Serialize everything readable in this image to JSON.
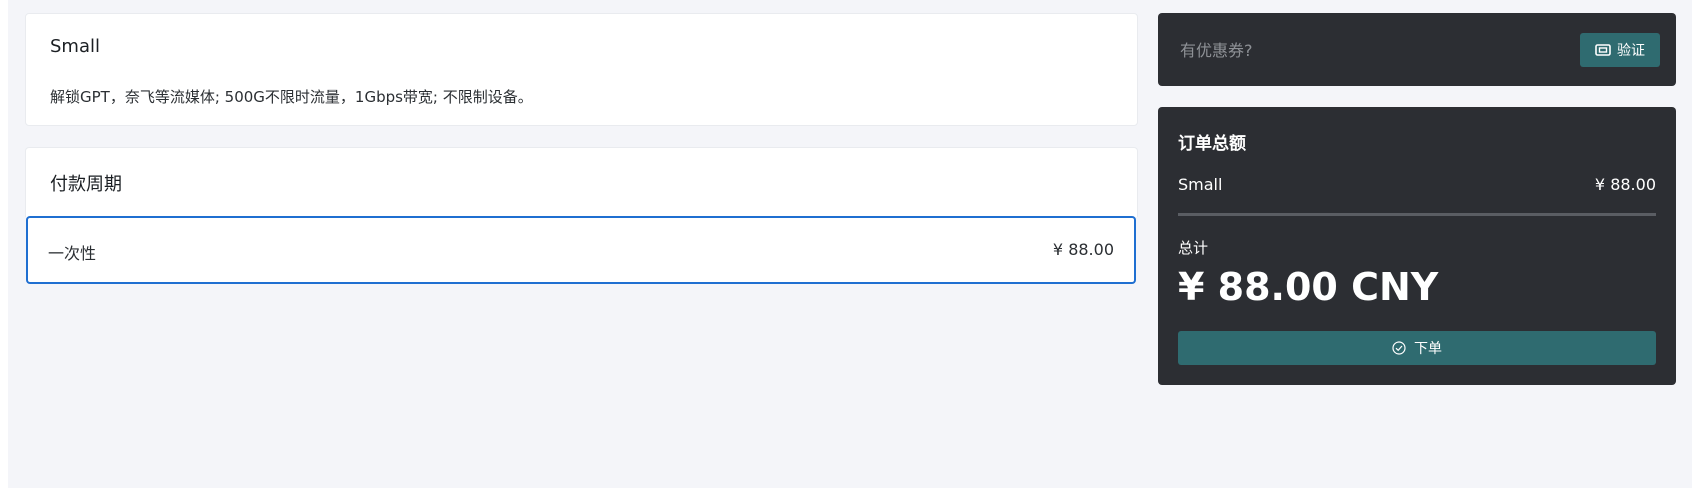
{
  "plan": {
    "name": "Small",
    "description": "解锁GPT，奈飞等流媒体; 500G不限时流量，1Gbps带宽; 不限制设备。"
  },
  "billing": {
    "title": "付款周期",
    "option": {
      "label": "一次性",
      "price": "¥ 88.00"
    }
  },
  "coupon": {
    "placeholder": "有优惠券?",
    "value": "",
    "verify_label": "验证",
    "icon": "ticket-icon"
  },
  "summary": {
    "heading": "订单总额",
    "item_name": "Small",
    "item_price": "¥ 88.00",
    "total_label": "总计",
    "total_amount": "¥ 88.00 CNY",
    "order_label": "下单",
    "order_icon": "check-circle-icon"
  },
  "colors": {
    "accent": "#2f6b70",
    "selection_border": "#1f6fd1",
    "dark_panel": "#2c2e33",
    "page_background": "#f4f5f9"
  }
}
